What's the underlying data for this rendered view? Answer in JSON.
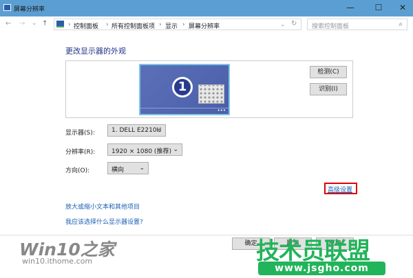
{
  "window": {
    "title": "屏幕分辨率",
    "minimize": "—",
    "maximize": "☐",
    "close": "✕"
  },
  "nav": {
    "back": "←",
    "forward": "→",
    "recent": "⌄",
    "up": "↑",
    "refresh": "↻",
    "dropdown": "⌄"
  },
  "breadcrumb": [
    "控制面板",
    "所有控制面板项",
    "显示",
    "屏幕分辨率"
  ],
  "search": {
    "placeholder": "搜索控制面板"
  },
  "main": {
    "heading": "更改显示器的外观",
    "monitor_number": "1",
    "detect_button": "检测(C)",
    "identify_button": "识别(I)",
    "display_label": "显示器(S):",
    "display_value": "1. DELL E2210H",
    "resolution_label": "分辨率(R):",
    "resolution_value": "1920 × 1080 (推荐)",
    "orientation_label": "方向(O):",
    "orientation_value": "横向",
    "advanced_link": "高级设置",
    "link_text_size": "放大或缩小文本和其他项目",
    "link_which_settings": "我应该选择什么显示器设置?"
  },
  "footer": {
    "ok": "确定",
    "cancel": "取消",
    "apply": "应用"
  },
  "watermarks": {
    "win10_logo": "Win10之家",
    "win10_url": "win10.ithome.com",
    "jsgho_logo": "技术员联盟",
    "jsgho_url": "www.jsgho.com"
  },
  "colors": {
    "titlebar": "#5b9fd2",
    "link": "#1a5fb4",
    "highlight": "#e00000",
    "watermark_green": "#22b45a"
  }
}
